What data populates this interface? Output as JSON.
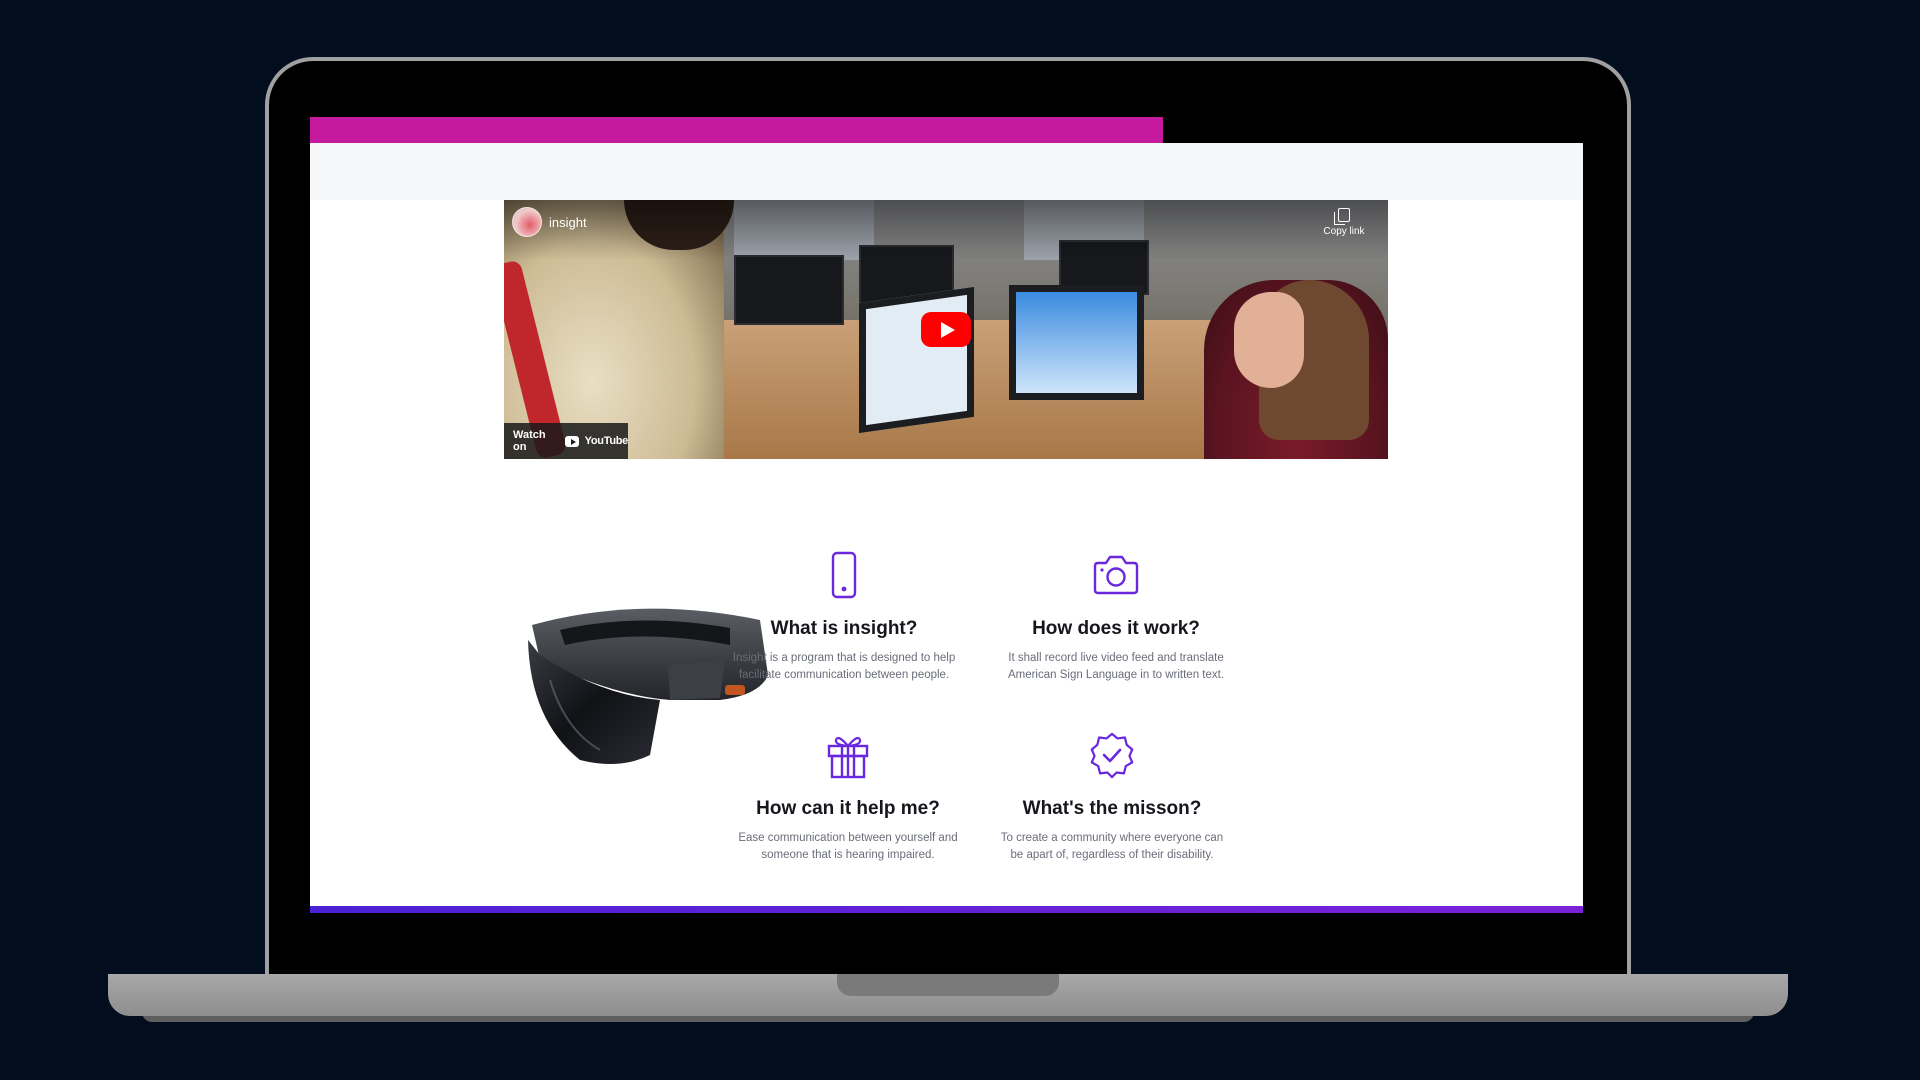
{
  "progress": {
    "fraction": 0.67,
    "color": "#c5199e"
  },
  "video": {
    "channel_title": "insight",
    "copy_link_label": "Copy link",
    "watch_on_label": "Watch on",
    "youtube_label": "YouTube"
  },
  "features": [
    {
      "icon": "phone-icon",
      "title": "What is insight?",
      "description": "Insight is a program that is designed to help facilitate communication between people."
    },
    {
      "icon": "camera-icon",
      "title": "How does it work?",
      "description": "It shall record live video feed and translate American Sign Language in to written text."
    },
    {
      "icon": "gift-icon",
      "title": "How can it help me?",
      "description": "Ease communication between yourself and someone that is hearing impaired."
    },
    {
      "icon": "badge-check-icon",
      "title": "What's the misson?",
      "description": "To create a community where everyone can be apart of, regardless of their disability."
    }
  ],
  "colors": {
    "accent_purple": "#6a27e0",
    "progress_magenta": "#c5199e",
    "footer_bar": "#5b22d7"
  }
}
